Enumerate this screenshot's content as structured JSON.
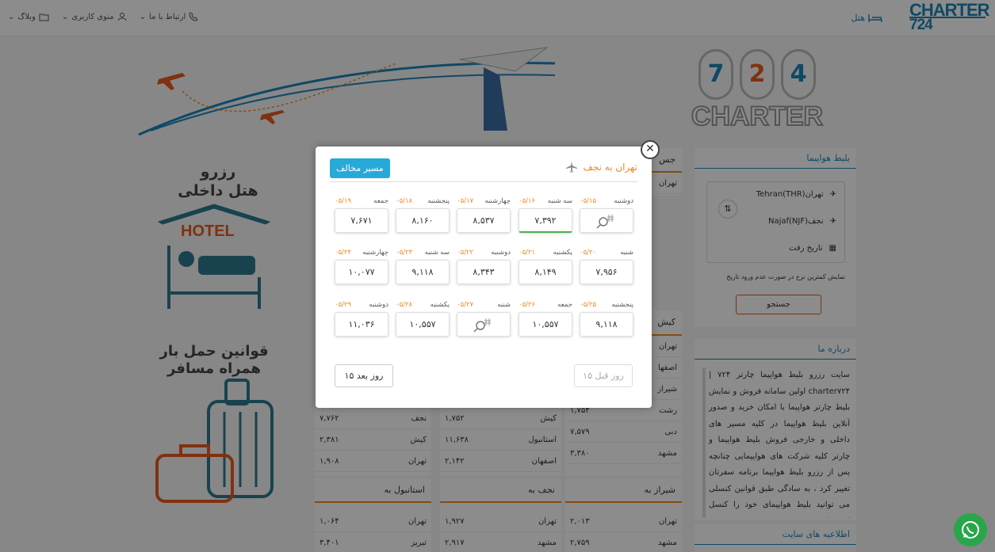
{
  "header": {
    "logo_line1": "CHARTER",
    "logo_line2": "724",
    "hotel": "هتل",
    "nav": [
      {
        "label": "ارتباط با ما",
        "icon": "phone-icon"
      },
      {
        "label": "منوی کاربری",
        "icon": "user-icon"
      },
      {
        "label": "وبلاگ",
        "icon": "folder-icon"
      }
    ]
  },
  "banner": {
    "digits": [
      "7",
      "2",
      "4"
    ],
    "word": "CHARTER"
  },
  "left_promo": {
    "hotel_title_1": "رزرو",
    "hotel_title_2": "هتل داخلی",
    "hotel_sign": "HOTEL",
    "baggage_1": "قوانین حمل بار",
    "baggage_2": "همراه مسافر"
  },
  "search": {
    "title": "بلیط هواپیما",
    "origin": "تهران(Tehran(THR",
    "destination": "نجف(Najaf(NJF",
    "date_placeholder": "تاریخ رفت",
    "hint": "نمایش کمترین نرخ در صورت عدم ورود تاریخ",
    "button": "جستجو"
  },
  "about": {
    "title": "درباره ما",
    "text": "سایت رزرو بلیط هواپیما چارتر ۷۲۴ | charter۷۲۴ اولین سامانه فروش و نمایش بلیط چارتر هواپیما با امکان خرید و صدور آنلاین بلیط هواپیما در کلیه مسیر های داخلی و خارجی فروش بلیط هواپیما و چارتر کلیه شرکت های هواپیمایی چنانچه پس از رزرو بلیط هواپیما برنامه سفرتان تغییر کرد ، به سادگی طبق قوانین کنسلی می توانید بلیط هواپیمای خود را کنسل کنید. با",
    "site_news": "اطلاعیه های سایت"
  },
  "behind_columns": {
    "col_top_label": "جس",
    "col_top_row": "تهران",
    "kish_head": "کیش",
    "col3_rows": [
      {
        "city": "تهران",
        "price": ""
      },
      {
        "city": "اصفها",
        "price": ""
      },
      {
        "city": "شیراز",
        "price": ""
      },
      {
        "city": "رشت",
        "price": "۱,۷۵۴"
      },
      {
        "city": "دبی",
        "price": "۷,۵۷۹"
      },
      {
        "city": "مشهد",
        "price": "۳,۳۸۰"
      }
    ],
    "col2_rows": [
      {
        "city": "کیش",
        "price": "۱,۷۵۲"
      },
      {
        "city": "استانبول",
        "price": "۱۱,۶۳۸"
      },
      {
        "city": "اصفهان",
        "price": "۲,۱۴۲"
      }
    ],
    "col1_rows": [
      {
        "city": "نجف",
        "price": "۷,۷۶۲"
      },
      {
        "city": "کیش",
        "price": "۲,۳۸۱"
      },
      {
        "city": "تهران",
        "price": "۱,۹۰۸"
      }
    ],
    "heads_bottom": [
      "شیراز به",
      "نجف به",
      "استانبول به"
    ],
    "bottom_col3": [
      {
        "city": "تهران",
        "price": "۲,۰۱۳"
      },
      {
        "city": "مشهد",
        "price": "۲,۷۵۹"
      }
    ],
    "bottom_col2": [
      {
        "city": "تهران",
        "price": "۱,۹۲۷"
      },
      {
        "city": "مشهد",
        "price": "۲,۹۱۷"
      }
    ],
    "bottom_col1": [
      {
        "city": "تهران",
        "price": "۱,۰۶۴"
      },
      {
        "city": "تبریز",
        "price": "۳,۴۰۱"
      }
    ]
  },
  "modal": {
    "title": "تهران به نجف",
    "reverse_button": "مسیر مخالف",
    "next_button": "۱۵ روز بعد",
    "prev_button": "۱۵ روز قبل",
    "days": [
      {
        "day": "دوشنبه",
        "date": "۰۵/۱۵",
        "price": "",
        "search": true
      },
      {
        "day": "سه شنبه",
        "date": "۰۵/۱۶",
        "price": "۷,۳۹۲",
        "selected": true
      },
      {
        "day": "چهارشنبه",
        "date": "۰۵/۱۷",
        "price": "۸,۵۳۷"
      },
      {
        "day": "پنجشنبه",
        "date": "۰۵/۱۸",
        "price": "۸,۱۶۰"
      },
      {
        "day": "جمعه",
        "date": "۰۵/۱۹",
        "price": "۷,۶۷۱"
      },
      {
        "day": "شنبه",
        "date": "۰۵/۲۰",
        "price": "۷,۹۵۶"
      },
      {
        "day": "یکشنبه",
        "date": "۰۵/۲۱",
        "price": "۸,۱۴۹"
      },
      {
        "day": "دوشنبه",
        "date": "۰۵/۲۲",
        "price": "۸,۳۴۳"
      },
      {
        "day": "سه شنبه",
        "date": "۰۵/۲۳",
        "price": "۹,۱۱۸"
      },
      {
        "day": "چهارشنبه",
        "date": "۰۵/۲۴",
        "price": "۱۰,۰۷۷"
      },
      {
        "day": "پنجشنبه",
        "date": "۰۵/۲۵",
        "price": "۹,۱۱۸"
      },
      {
        "day": "جمعه",
        "date": "۰۵/۲۶",
        "price": "۱۰,۵۵۷"
      },
      {
        "day": "شنبه",
        "date": "۰۵/۲۷",
        "price": "",
        "search": true
      },
      {
        "day": "یکشنبه",
        "date": "۰۵/۲۸",
        "price": "۱۰,۵۵۷"
      },
      {
        "day": "دوشنبه",
        "date": "۰۵/۲۹",
        "price": "۱۱,۰۳۶"
      }
    ]
  },
  "colors": {
    "accent": "#1d86b8",
    "orange": "#f08a24",
    "button": "#27aad8",
    "selected": "#4caf50"
  }
}
